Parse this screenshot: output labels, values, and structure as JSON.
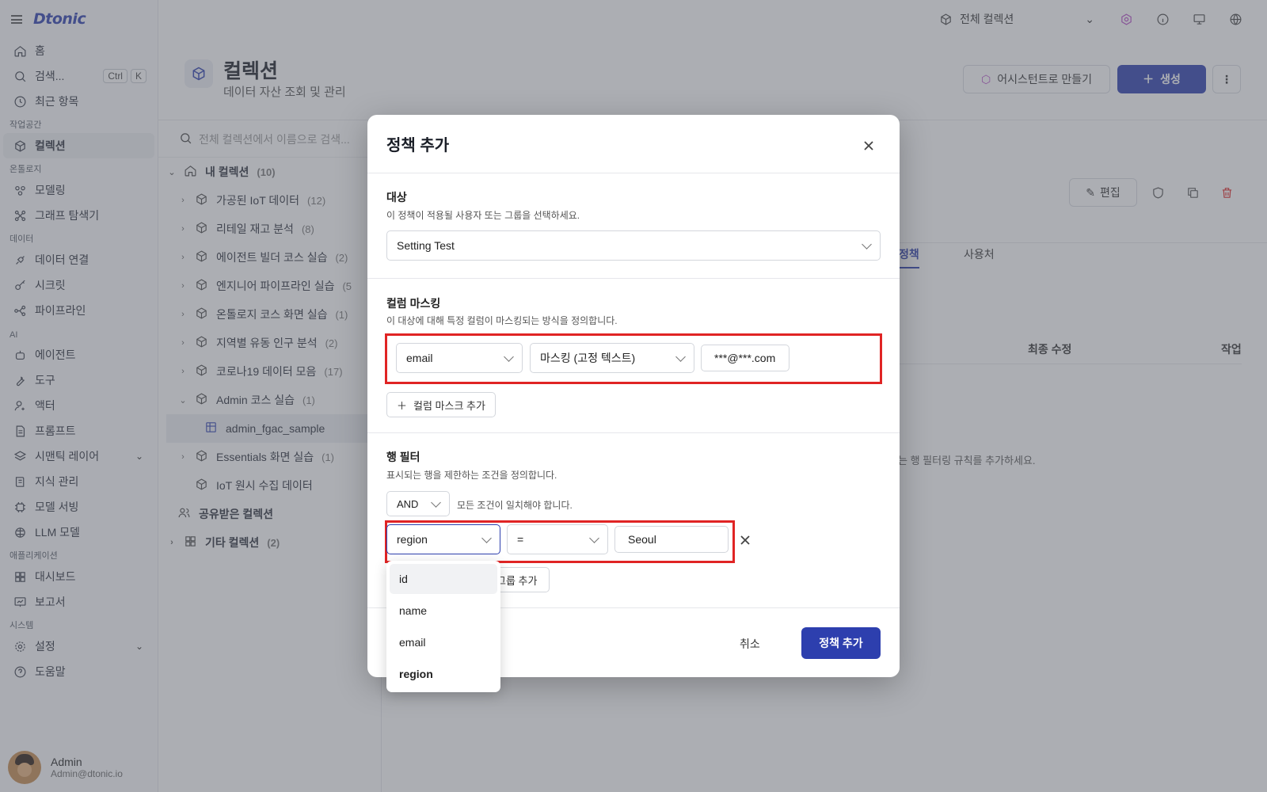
{
  "app": {
    "logo": "Dtonic"
  },
  "sidebar": {
    "home": "홈",
    "search": "검색...",
    "search_keys": [
      "Ctrl",
      "K"
    ],
    "recent": "최근 항목",
    "sections": {
      "workspace": "작업공간",
      "ontology": "온톨로지",
      "data": "데이터",
      "ai": "AI",
      "apps": "애플리케이션",
      "system": "시스템"
    },
    "collection": "컬렉션",
    "modeling": "모델링",
    "graph": "그래프 탐색기",
    "data_connect": "데이터 연결",
    "secret": "시크릿",
    "pipeline": "파이프라인",
    "agent": "에이전트",
    "tool": "도구",
    "actor": "액터",
    "prompt": "프롬프트",
    "semantic": "시맨틱 레이어",
    "knowledge": "지식 관리",
    "serving": "모델 서빙",
    "llm": "LLM 모델",
    "dashboard": "대시보드",
    "report": "보고서",
    "settings": "설정",
    "help": "도움말"
  },
  "user": {
    "name": "Admin",
    "email": "Admin@dtonic.io"
  },
  "topbar": {
    "collection_select": "전체 컬렉션"
  },
  "page": {
    "title": "컬렉션",
    "subtitle": "데이터 자산 조회 및 관리",
    "assistant_btn": "어시스턴트로 만들기",
    "create_btn": "생성"
  },
  "tree": {
    "search_placeholder": "전체 컬렉션에서 이름으로 검색...",
    "my_collections": "내 컬렉션",
    "my_count": "(10)",
    "items": [
      {
        "label": "가공된 IoT 데이터",
        "count": "(12)"
      },
      {
        "label": "리테일 재고 분석",
        "count": "(8)"
      },
      {
        "label": "에이전트 빌더 코스 실습",
        "count": "(2)"
      },
      {
        "label": "엔지니어 파이프라인 실습",
        "count": "(5"
      },
      {
        "label": "온톨로지 코스 화면 실습",
        "count": "(1)"
      },
      {
        "label": "지역별 유동 인구 분석",
        "count": "(2)"
      },
      {
        "label": "코로나19 데이터 모음",
        "count": "(17)"
      },
      {
        "label": "Admin 코스 실습",
        "count": "(1)"
      }
    ],
    "child": "admin_fgac_sample",
    "after_items": [
      {
        "label": "Essentials 화면 실습",
        "count": "(1)"
      },
      {
        "label": "IoT 원시 수집 데이터",
        "count": ""
      }
    ],
    "shared": "공유받은 컬렉션",
    "other": "기타 컬렉션",
    "other_count": "(2)"
  },
  "detail": {
    "edit_btn": "편집",
    "tab_policy": "정책",
    "tab_usage": "사용처",
    "col_modified": "최종 수정",
    "col_action": "작업",
    "empty_msg": "는 행 필터링 규칙를 추가하세요."
  },
  "modal": {
    "title": "정책 추가",
    "target": {
      "title": "대상",
      "desc": "이 정책이 적용될 사용자 또는 그룹을 선택하세요.",
      "value": "Setting Test"
    },
    "masking": {
      "title": "컬럼 마스킹",
      "desc": "이 대상에 대해 특정 컬럼이 마스킹되는 방식을 정의합니다.",
      "column": "email",
      "method": "마스킹 (고정 텍스트)",
      "text": "***@***.com",
      "add_btn": "컬럼 마스크 추가"
    },
    "row_filter": {
      "title": "행 필터",
      "desc": "표시되는 행을 제한하는 조건을 정의합니다.",
      "logic": "AND",
      "logic_desc": "모든 조건이 일치해야 합니다.",
      "column": "region",
      "operator": "=",
      "value": "Seoul",
      "add_group_btn": "그룹 추가"
    },
    "cancel": "취소",
    "submit": "정책 추가"
  },
  "dropdown": {
    "options": [
      "id",
      "name",
      "email",
      "region"
    ],
    "hovered": "id",
    "selected": "region"
  }
}
